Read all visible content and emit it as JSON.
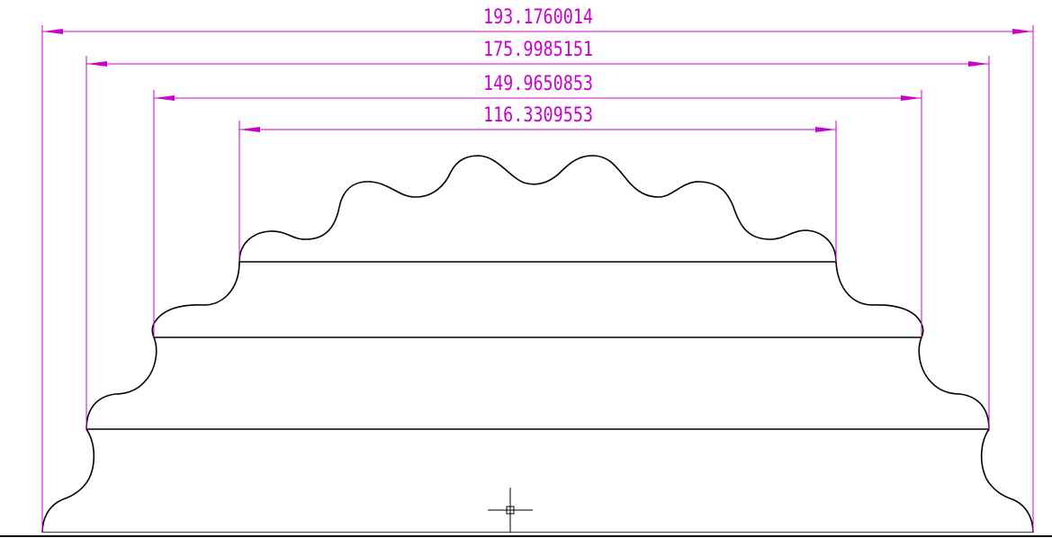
{
  "drawing": {
    "background_color": "#ffffff",
    "outline_color": "#000000",
    "dimension_color": "#cc00cc"
  },
  "dimensions": [
    {
      "label": "193.1760014"
    },
    {
      "label": "175.9985151"
    },
    {
      "label": "149.9650853"
    },
    {
      "label": "116.3309553"
    }
  ],
  "cursor": {
    "visible": true
  }
}
